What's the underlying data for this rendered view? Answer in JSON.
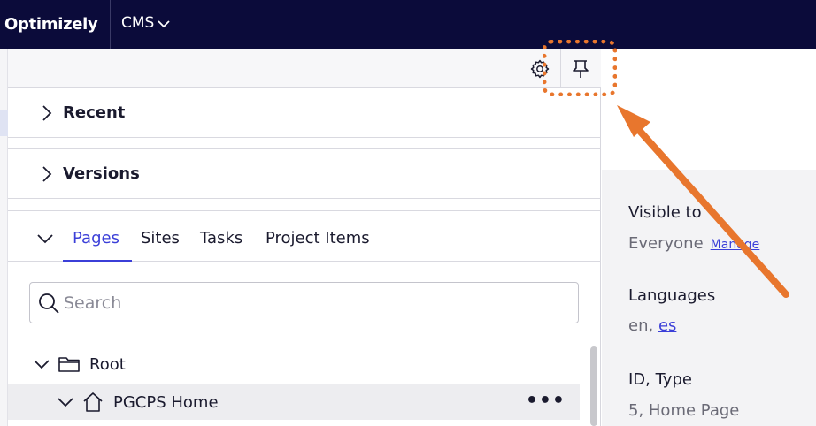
{
  "topbar": {
    "brand": "Optimizely",
    "menu_label": "CMS"
  },
  "panel": {
    "toolbar": {
      "settings_icon": "gear-icon",
      "pin_icon": "pin-icon"
    },
    "sections": [
      {
        "label": "Recent",
        "expanded": false
      },
      {
        "label": "Versions",
        "expanded": false
      }
    ],
    "tabs": [
      "Pages",
      "Sites",
      "Tasks",
      "Project Items"
    ],
    "active_tab": "Pages",
    "search": {
      "placeholder": "Search",
      "value": ""
    },
    "tree": [
      {
        "label": "Root",
        "icon": "folder-icon",
        "expanded": true
      },
      {
        "label": "PGCPS Home",
        "icon": "home-icon",
        "expanded": true,
        "actions": "•••"
      }
    ]
  },
  "info": {
    "visible_to_label": "Visible to",
    "visible_to_value": "Everyone",
    "manage_link": "Manage",
    "languages_label": "Languages",
    "languages_value_prefix": "en, ",
    "languages_link": "es",
    "id_type_label": "ID, Type",
    "id_type_value": "5, Home Page"
  },
  "annotation": {
    "color": "#e8762d"
  },
  "colors": {
    "topbar_bg": "#0b0b3a",
    "accent": "#3b3fd8"
  }
}
